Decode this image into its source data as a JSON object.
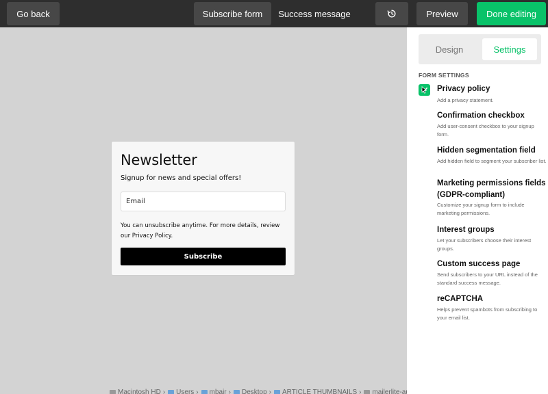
{
  "topbar": {
    "back_label": "Go back",
    "subscribe_form_label": "Subscribe form",
    "success_message_label": "Success message",
    "history_icon": "history-icon",
    "preview_label": "Preview",
    "done_label": "Done editing"
  },
  "form": {
    "title": "Newsletter",
    "subtitle": "Signup for news and special offers!",
    "email_placeholder": "Email",
    "note": "You can unsubscribe anytime. For more details, review our Privacy Policy.",
    "submit_label": "Subscribe"
  },
  "pathbar": {
    "segments": [
      "Macintosh HD",
      "Users",
      "mbair",
      "Desktop",
      "ARTICLE THUMBNAILS",
      "mailerlite-autoresponder-review.webp"
    ]
  },
  "sidebar": {
    "tabs": {
      "design": "Design",
      "settings": "Settings"
    },
    "active_tab": "settings",
    "section_label": "FORM SETTINGS",
    "options": [
      {
        "title": "Privacy policy",
        "desc": "Add a privacy statement.",
        "checked": true
      },
      {
        "title": "Confirmation checkbox",
        "desc": "Add user-consent checkbox to your signup form.",
        "checked": false
      },
      {
        "title": "Hidden segmentation field",
        "desc": "Add hidden field to segment your subscriber list.",
        "checked": false
      },
      {
        "title": "Marketing permissions fields (GDPR-compliant)",
        "desc": "Customize your signup form to include marketing permissions.",
        "checked": false
      },
      {
        "title": "Interest groups",
        "desc": "Let your subscribers choose their interest groups.",
        "checked": false
      },
      {
        "title": "Custom success page",
        "desc": "Send subscribers to your URL instead of the standard success message.",
        "checked": false
      },
      {
        "title": "reCAPTCHA",
        "desc": "Helps prevent spambots from subscribing to your email list.",
        "checked": false
      }
    ]
  },
  "colors": {
    "accent": "#09c269",
    "topbar": "#2e2e2e",
    "canvas": "#d3d3d3"
  }
}
